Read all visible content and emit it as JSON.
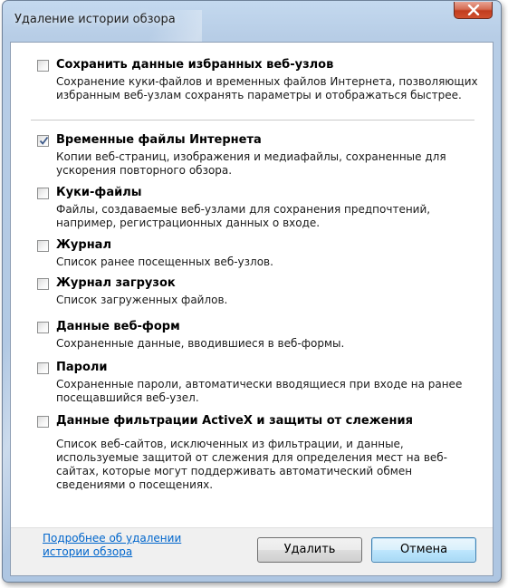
{
  "window": {
    "title": "Удаление истории обзора"
  },
  "options": [
    {
      "label": "Сохранить данные избранных веб-узлов",
      "description": "Сохранение куки-файлов и временных файлов Интернета, позволяющих избранным веб-узлам сохранять параметры и отображаться быстрее.",
      "checked": false
    },
    {
      "label": "Временные файлы Интернета",
      "description": "Копии веб-страниц, изображения и медиафайлы, сохраненные для ускорения повторного обзора.",
      "checked": true
    },
    {
      "label": "Куки-файлы",
      "description": "Файлы, создаваемые веб-узлами для сохранения предпочтений, например, регистрационных данных о входе.",
      "checked": false
    },
    {
      "label": "Журнал",
      "description": "Список ранее посещенных веб-узлов.",
      "checked": false
    },
    {
      "label": "Журнал загрузок",
      "description": "Список загруженных файлов.",
      "checked": false
    },
    {
      "label": "Данные веб-форм",
      "description": "Сохраненные данные, вводившиеся в веб-формы.",
      "checked": false
    },
    {
      "label": "Пароли",
      "description": "Сохраненные пароли, автоматически вводящиеся при входе на ранее посещавшийся веб-узел.",
      "checked": false
    },
    {
      "label": "Данные фильтрации ActiveX и защиты от слежения",
      "description": "Список веб-сайтов, исключенных из фильтрации, и данные, используемые защитой от слежения для определения мест на веб-сайтах, которые могут поддерживать автоматический обмен сведениями о посещениях.",
      "checked": false
    }
  ],
  "footer": {
    "help_link": "Подробнее об удалении истории обзора",
    "delete_label": "Удалить",
    "cancel_label": "Отмена"
  },
  "colors": {
    "link": "#0066cc",
    "close_button": "#c13c1e",
    "frame": "#b7cde6"
  }
}
